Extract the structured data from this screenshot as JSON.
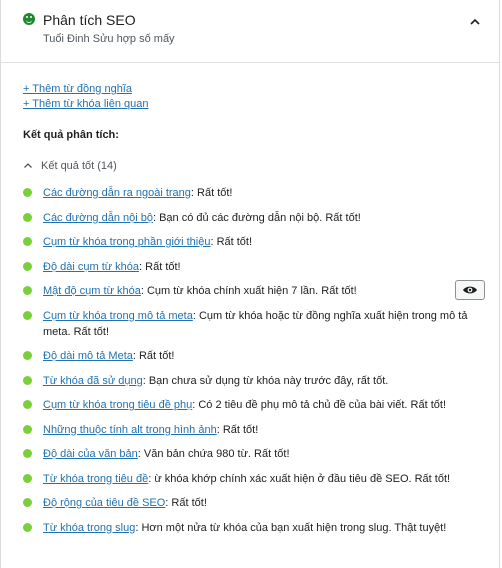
{
  "header": {
    "title": "Phân tích SEO",
    "subtitle": "Tuổi Đinh Sửu hợp số mấy"
  },
  "links": {
    "add_synonym": "+ Thêm từ đồng nghĩa",
    "add_related": "+ Thêm từ khóa liên quan"
  },
  "results": {
    "heading": "Kết quả phân tích:",
    "group_label": "Kết quả tốt (14)",
    "items": [
      {
        "link": "Các đường dẫn ra ngoài trang",
        "text": ": Rất tốt!"
      },
      {
        "link": "Các đường dẫn nội bộ",
        "text": ": Bạn có đủ các đường dẫn nội bộ. Rất tốt!"
      },
      {
        "link": "Cụm từ khóa trong phần giới thiệu",
        "text": ": Rất tốt!"
      },
      {
        "link": "Độ dài cụm từ khóa",
        "text": ": Rất tốt!"
      },
      {
        "link": "Mật độ cụm từ khóa",
        "text": ": Cụm từ khóa chính xuất hiện 7 lần. Rất tốt!"
      },
      {
        "link": "Cụm từ khóa trong mô tả meta",
        "text": ": Cụm từ khóa hoặc từ đồng nghĩa xuất hiện trong mô tả meta. Rất tốt!"
      },
      {
        "link": "Độ dài mô tả Meta",
        "text": ": Rất tốt!"
      },
      {
        "link": "Từ khóa đã sử dụng",
        "text": ": Bạn chưa sử dụng từ khóa này trước đây, rất tốt."
      },
      {
        "link": "Cụm từ khóa trong tiêu đề phụ",
        "text": ": Có 2 tiêu đề phụ mô tả chủ đề của bài viết. Rất tốt!"
      },
      {
        "link": "Những thuộc tính alt trong hình ảnh",
        "text": ": Rất tốt!"
      },
      {
        "link": "Độ dài của văn bản",
        "text": ": Văn bản chứa 980 từ. Rất tốt!"
      },
      {
        "link": "Từ khóa trong tiêu đề",
        "text": ": ừ khóa khớp chính xác xuất hiện ở đầu tiêu đề SEO. Rất tốt!"
      },
      {
        "link": "Độ rộng của tiêu đề SEO",
        "text": ": Rất tốt!"
      },
      {
        "link": "Từ khóa trong slug",
        "text": ": Hơn một nửa từ khóa của bạn xuất hiện trong slug. Thật tuyệt!"
      }
    ]
  },
  "icons": {
    "status": "smiley-icon",
    "collapse": "chevron-up-icon",
    "group": "chevron-up-icon",
    "highlight": "eye-icon"
  },
  "colors": {
    "good": "#7ad03a",
    "link": "#2271b1",
    "status": "#1e8a2e"
  }
}
